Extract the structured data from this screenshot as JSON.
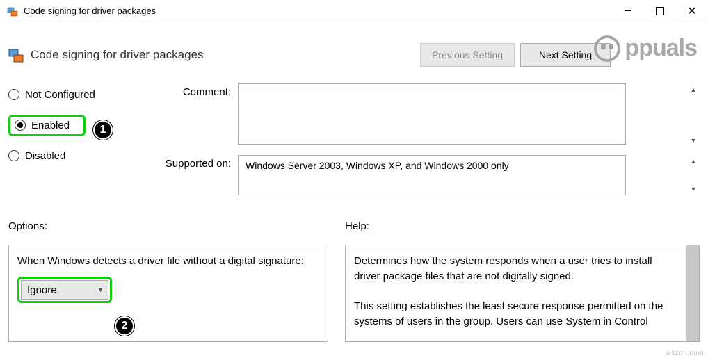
{
  "titlebar": {
    "title": "Code signing for driver packages"
  },
  "header": {
    "title": "Code signing for driver packages",
    "prev_button": "Previous Setting",
    "next_button": "Next Setting"
  },
  "radios": {
    "not_configured": "Not Configured",
    "enabled": "Enabled",
    "disabled": "Disabled"
  },
  "form": {
    "comment_label": "Comment:",
    "comment_value": "",
    "supported_label": "Supported on:",
    "supported_value": "Windows Server 2003, Windows XP, and Windows 2000 only"
  },
  "lower": {
    "options_label": "Options:",
    "help_label": "Help:",
    "options_text": "When Windows detects a driver file without a digital signature:",
    "dropdown_value": "Ignore",
    "help_text_1": "Determines how the system responds when a user tries to install driver package files that are not digitally signed.",
    "help_text_2": "This setting establishes the least secure response permitted on the systems of users in the group. Users can use System in Control"
  },
  "badges": {
    "one": "1",
    "two": "2"
  },
  "watermark": {
    "text": "ppuals",
    "footer": "wsxdn.com"
  }
}
